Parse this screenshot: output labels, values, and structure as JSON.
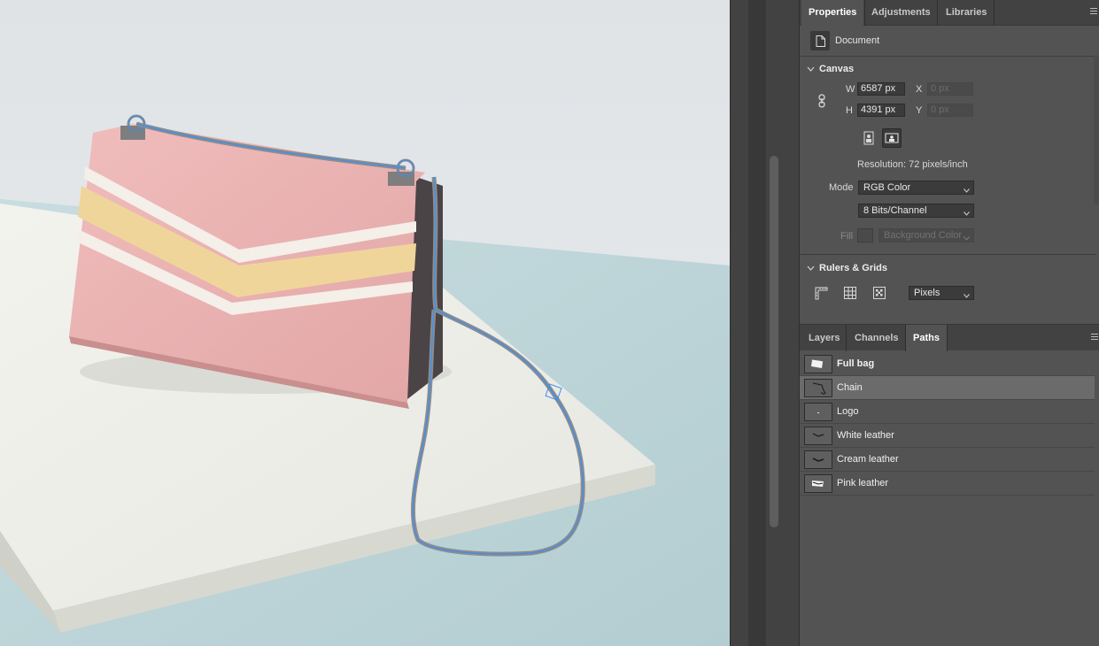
{
  "properties_tabs": [
    {
      "label": "Properties",
      "active": true
    },
    {
      "label": "Adjustments",
      "active": false
    },
    {
      "label": "Libraries",
      "active": false
    }
  ],
  "document_label": "Document",
  "canvas": {
    "title": "Canvas",
    "w_label": "W",
    "h_label": "H",
    "x_label": "X",
    "y_label": "Y",
    "width_value": "6587 px",
    "height_value": "4391 px",
    "x_value": "0 px",
    "y_value": "0 px",
    "resolution": "Resolution: 72 pixels/inch",
    "mode_label": "Mode",
    "mode_value": "RGB Color",
    "bits_value": "8 Bits/Channel",
    "fill_label": "Fill",
    "fill_value": "Background Color"
  },
  "rulers": {
    "title": "Rulers & Grids",
    "units_value": "Pixels"
  },
  "bottom_tabs": [
    {
      "label": "Layers",
      "active": false
    },
    {
      "label": "Channels",
      "active": false
    },
    {
      "label": "Paths",
      "active": true
    }
  ],
  "paths": [
    {
      "name": "Full bag",
      "selected": false,
      "bold": true
    },
    {
      "name": "Chain",
      "selected": true,
      "bold": false
    },
    {
      "name": "Logo",
      "selected": false,
      "bold": false
    },
    {
      "name": "White leather",
      "selected": false,
      "bold": false
    },
    {
      "name": "Cream leather",
      "selected": false,
      "bold": false
    },
    {
      "name": "Pink leather",
      "selected": false,
      "bold": false
    }
  ],
  "colors": {
    "panel_bg": "#535353",
    "tab_bg": "#424242",
    "selection_row": "#6b6b6b",
    "path_outline": "#3d8ef0",
    "bag_pink": "#eab2b1",
    "bag_yellow": "#f0d59b"
  },
  "icons": [
    "document-icon",
    "chain-link-icon",
    "portrait-icon",
    "landscape-icon",
    "ruler-icon",
    "grid-icon",
    "transparency-grid-icon",
    "panel-menu-icon",
    "chevron-down-icon"
  ]
}
